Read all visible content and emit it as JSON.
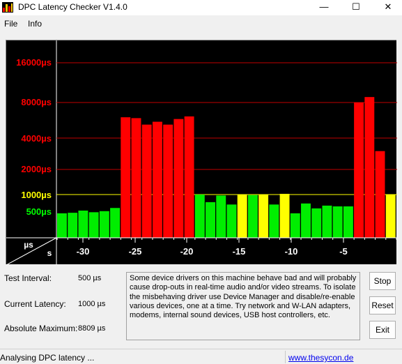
{
  "window": {
    "title": "DPC Latency Checker V1.4.0",
    "min_glyph": "—",
    "max_glyph": "☐",
    "close_glyph": "✕"
  },
  "menu": [
    "File",
    "Info"
  ],
  "graph": {
    "y_labels": [
      {
        "text": "16000µs",
        "color": "#ff0000"
      },
      {
        "text": "8000µs",
        "color": "#ff0000"
      },
      {
        "text": "4000µs",
        "color": "#ff0000"
      },
      {
        "text": "2000µs",
        "color": "#ff0000"
      },
      {
        "text": "1000µs",
        "color": "#ffff00"
      },
      {
        "text": "500µs",
        "color": "#00ff00"
      }
    ],
    "corner_y_unit": "µs",
    "corner_x_unit": "s",
    "x_ticks": [
      "-30",
      "-25",
      "-20",
      "-15",
      "-10",
      "-5"
    ],
    "colors": {
      "red": "#ff0000",
      "yellow": "#ffff00",
      "green": "#00ee00"
    },
    "bars": [
      "green",
      "green",
      "green",
      "green",
      "green",
      "green",
      "red",
      "red",
      "red",
      "red",
      "red",
      "red",
      "red",
      "green",
      "green",
      "green",
      "green",
      "yellow",
      "green",
      "yellow",
      "green",
      "yellow",
      "green",
      "green",
      "green",
      "green",
      "green",
      "green",
      "red",
      "red",
      "red",
      "yellow"
    ],
    "bar_levels": [
      450,
      460,
      500,
      470,
      490,
      560,
      6000,
      5900,
      5200,
      5500,
      5200,
      5800,
      6100,
      1000,
      720,
      960,
      650,
      990,
      980,
      990,
      650,
      1020,
      450,
      680,
      550,
      620,
      600,
      600,
      8000,
      8800,
      3000,
      990
    ]
  },
  "info": {
    "test_interval_label": "Test Interval:",
    "test_interval_value": "500 µs",
    "current_latency_label": "Current Latency:",
    "current_latency_value": "1000 µs",
    "absolute_maximum_label": "Absolute Maximum:",
    "absolute_maximum_value": "8809 µs",
    "description": "Some device drivers on this machine behave bad and will probably cause drop-outs in real-time audio and/or video streams. To isolate the misbehaving driver use Device Manager and disable/re-enable various devices, one at a time. Try network and W-LAN adapters, modems, internal sound devices, USB host controllers, etc."
  },
  "buttons": {
    "stop": "Stop",
    "reset": "Reset",
    "exit": "Exit"
  },
  "status": {
    "text": "Analysing DPC latency ...",
    "link": "www.thesycon.de"
  }
}
